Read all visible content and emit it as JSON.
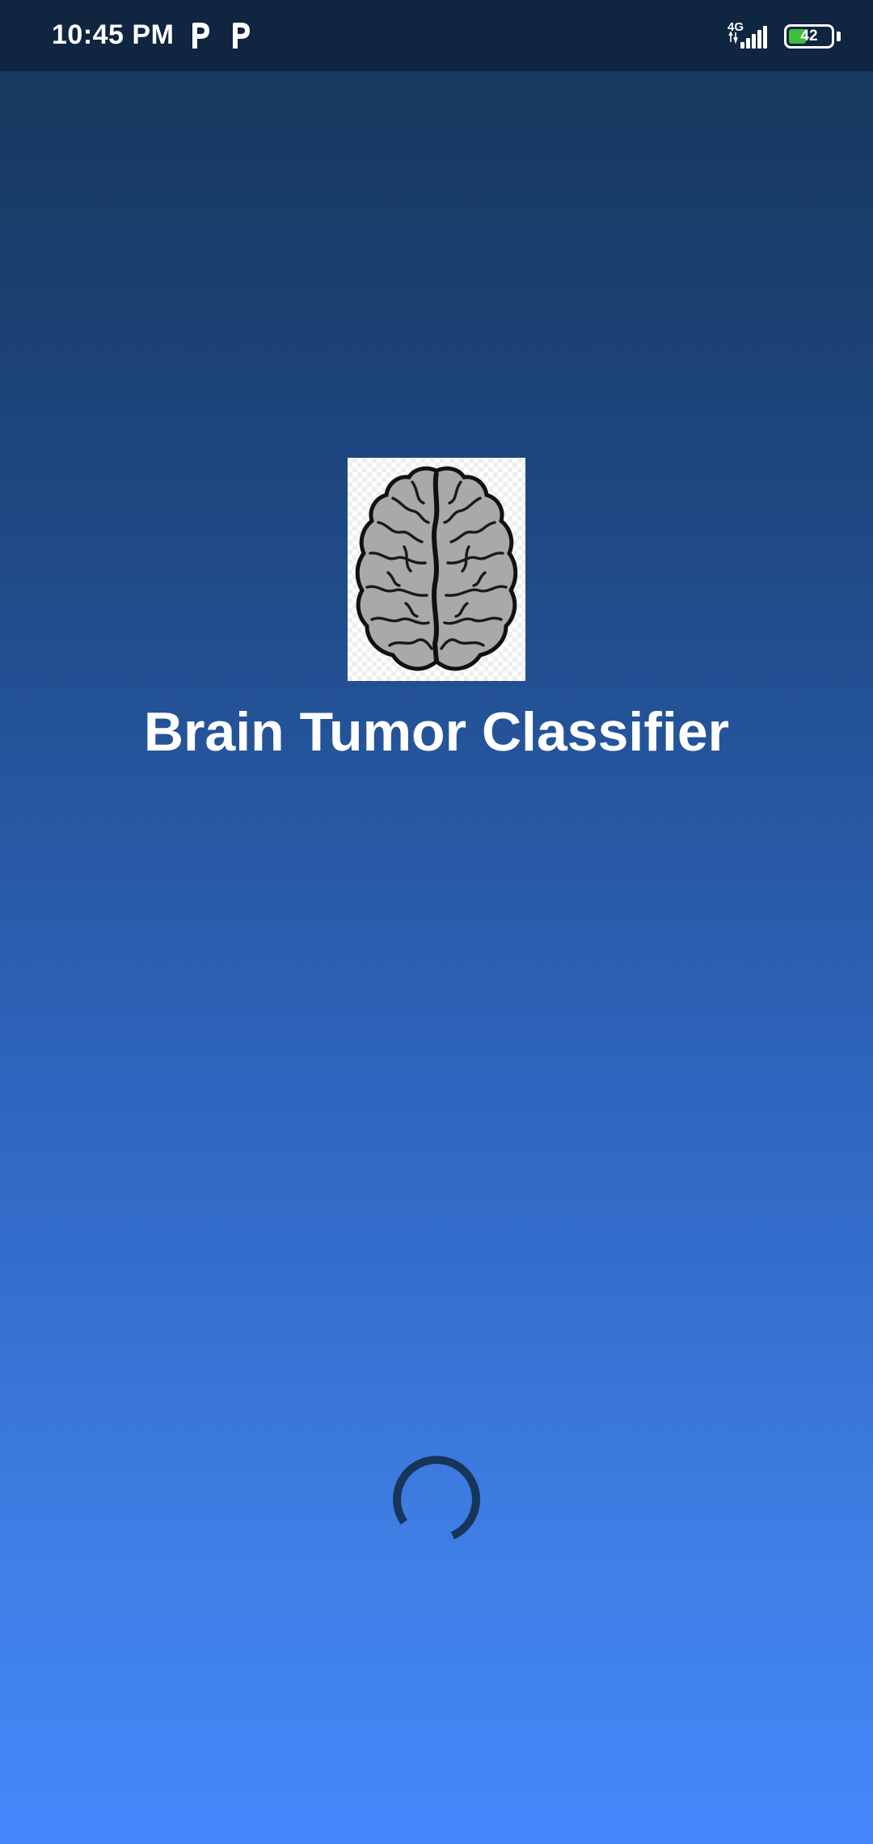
{
  "status_bar": {
    "time": "10:45 PM",
    "notification_icons": [
      "p-app-icon",
      "p-app-icon"
    ],
    "network_label": "4G",
    "battery_level": "42",
    "battery_fraction": 0.42
  },
  "splash": {
    "logo_icon": "brain-icon",
    "title": "Brain Tumor Classifier",
    "loading_indicator": "spinner"
  },
  "colors": {
    "status_bar": "#0f2540",
    "gradient_top": "#163559",
    "gradient_bottom": "#4387fb",
    "spinner": "#163559",
    "battery_fill": "#3fbd3f"
  }
}
